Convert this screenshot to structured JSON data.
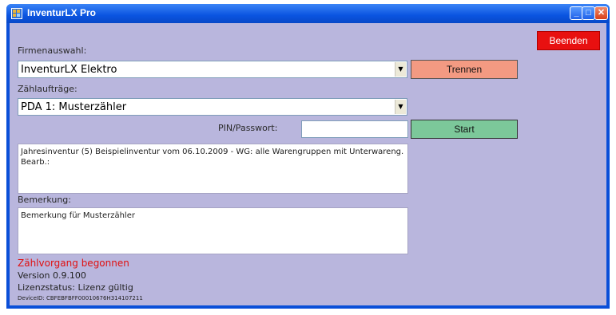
{
  "window": {
    "title": "InventurLX Pro",
    "minimize": "_",
    "maximize": "□",
    "close": "✕"
  },
  "buttons": {
    "quit": "Beenden",
    "disconnect": "Trennen",
    "start": "Start"
  },
  "company": {
    "label": "Firmenauswahl:",
    "selected": "InventurLX Elektro"
  },
  "count_orders": {
    "label": "Zählaufträge:",
    "selected": "PDA 1: Musterzähler"
  },
  "pin": {
    "label": "PIN/Passwort:",
    "value": ""
  },
  "description": "Jahresinventur (5) Beispielinventur vom 06.10.2009 - WG: alle Warengruppen mit Unterwareng. Bearb.:",
  "remark": {
    "label": "Bemerkung:",
    "value": "Bemerkung für Musterzähler"
  },
  "status": {
    "state": "Zählvorgang begonnen",
    "version": "Version 0.9.100",
    "license": "Lizenzstatus: Lizenz gültig",
    "device_id": "DeviceID: CBFEBFBFF00010676H314107211"
  },
  "colors": {
    "state": "#e01010",
    "quit_button": "#e81010",
    "disconnect_button": "#f39a82",
    "start_button": "#7cc89a",
    "client_bg": "#b9b6dd"
  }
}
